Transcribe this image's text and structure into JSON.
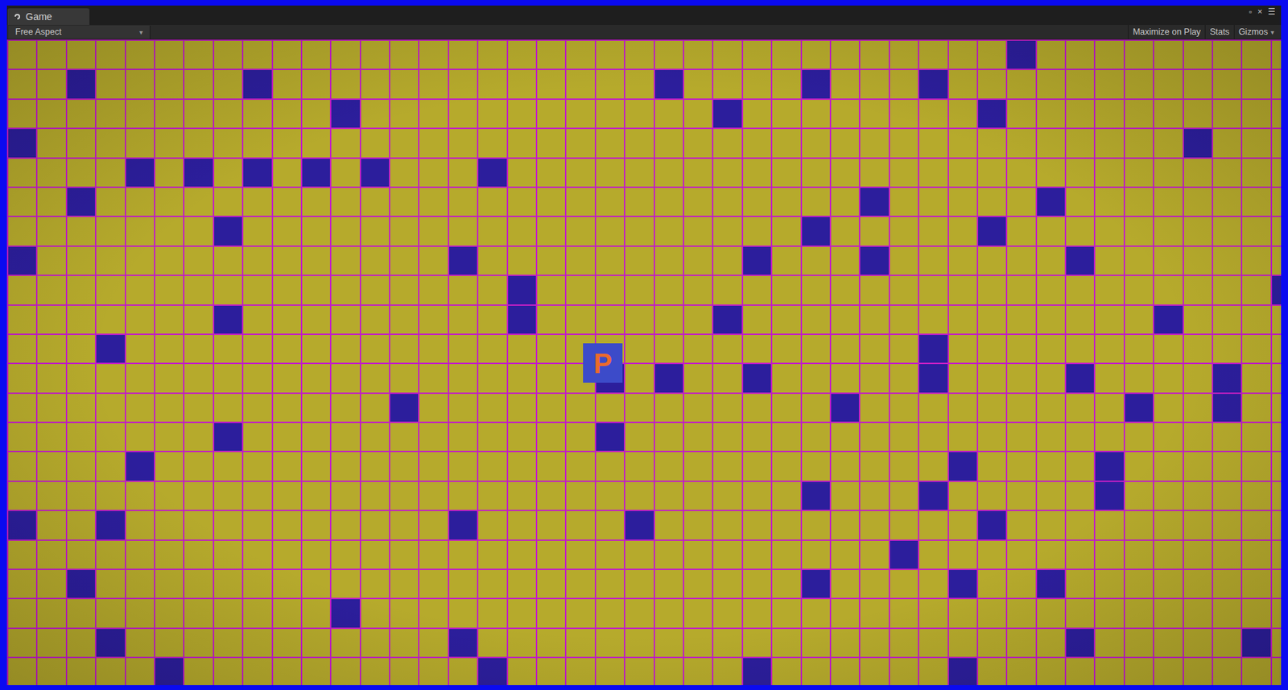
{
  "window": {
    "title": "Game",
    "controls": [
      "▫",
      "×",
      "☰"
    ]
  },
  "toolbar": {
    "aspect": "Free Aspect",
    "aspect_arrow": "▾",
    "buttons": [
      "Maximize on Play",
      "Stats",
      "Gizmos"
    ],
    "gizmos_arrow": "▾"
  },
  "grid": {
    "columns": 44,
    "rows": 22,
    "blocked": [
      [
        34,
        0
      ],
      [
        2,
        1
      ],
      [
        8,
        1
      ],
      [
        22,
        1
      ],
      [
        27,
        1
      ],
      [
        31,
        1
      ],
      [
        11,
        2
      ],
      [
        24,
        2
      ],
      [
        33,
        2
      ],
      [
        0,
        3
      ],
      [
        40,
        3
      ],
      [
        4,
        4
      ],
      [
        6,
        4
      ],
      [
        8,
        4
      ],
      [
        10,
        4
      ],
      [
        12,
        4
      ],
      [
        16,
        4
      ],
      [
        2,
        5
      ],
      [
        29,
        5
      ],
      [
        35,
        5
      ],
      [
        7,
        6
      ],
      [
        27,
        6
      ],
      [
        33,
        6
      ],
      [
        0,
        7
      ],
      [
        15,
        7
      ],
      [
        25,
        7
      ],
      [
        29,
        7
      ],
      [
        36,
        7
      ],
      [
        17,
        8
      ],
      [
        43,
        8
      ],
      [
        7,
        9
      ],
      [
        17,
        9
      ],
      [
        24,
        9
      ],
      [
        39,
        9
      ],
      [
        3,
        10
      ],
      [
        31,
        10
      ],
      [
        20,
        11
      ],
      [
        22,
        11
      ],
      [
        25,
        11
      ],
      [
        31,
        11
      ],
      [
        36,
        11
      ],
      [
        41,
        11
      ],
      [
        13,
        12
      ],
      [
        28,
        12
      ],
      [
        38,
        12
      ],
      [
        41,
        12
      ],
      [
        7,
        13
      ],
      [
        20,
        13
      ],
      [
        4,
        14
      ],
      [
        32,
        14
      ],
      [
        37,
        14
      ],
      [
        27,
        15
      ],
      [
        31,
        15
      ],
      [
        37,
        15
      ],
      [
        0,
        16
      ],
      [
        3,
        16
      ],
      [
        15,
        16
      ],
      [
        21,
        16
      ],
      [
        33,
        16
      ],
      [
        30,
        17
      ],
      [
        2,
        18
      ],
      [
        27,
        18
      ],
      [
        32,
        18
      ],
      [
        35,
        18
      ],
      [
        11,
        19
      ],
      [
        3,
        20
      ],
      [
        15,
        20
      ],
      [
        36,
        20
      ],
      [
        42,
        20
      ],
      [
        5,
        21
      ],
      [
        16,
        21
      ],
      [
        25,
        21
      ],
      [
        32,
        21
      ]
    ]
  },
  "player": {
    "label": "P",
    "col": 20,
    "row": 11
  }
}
